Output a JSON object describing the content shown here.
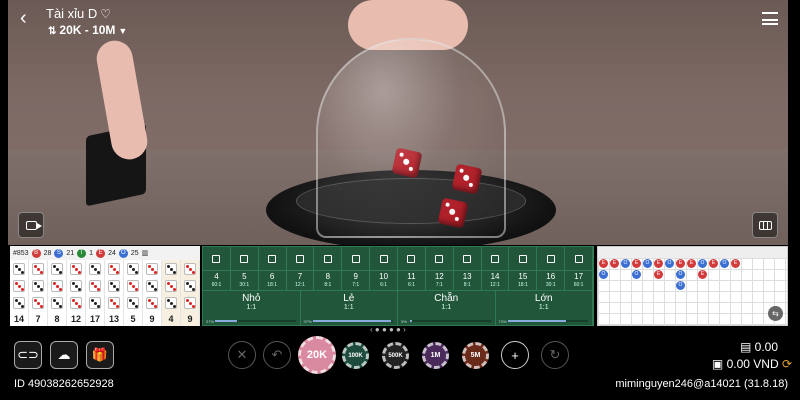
{
  "header": {
    "title": "Tài xỉu D",
    "limit": "20K - 10M"
  },
  "history": {
    "stats": {
      "round": "#853",
      "big": "28",
      "small": "21",
      "triple": "1",
      "even": "24",
      "odd": "25"
    },
    "sums": [
      "14",
      "7",
      "8",
      "12",
      "17",
      "13",
      "5",
      "9",
      "4",
      "9"
    ]
  },
  "board": {
    "totals": [
      {
        "n": "4",
        "o": "60:1"
      },
      {
        "n": "5",
        "o": "30:1"
      },
      {
        "n": "6",
        "o": "18:1"
      },
      {
        "n": "7",
        "o": "12:1"
      },
      {
        "n": "8",
        "o": "8:1"
      },
      {
        "n": "9",
        "o": "7:1"
      },
      {
        "n": "10",
        "o": "6:1"
      },
      {
        "n": "11",
        "o": "6:1"
      },
      {
        "n": "12",
        "o": "7:1"
      },
      {
        "n": "13",
        "o": "8:1"
      },
      {
        "n": "14",
        "o": "12:1"
      },
      {
        "n": "15",
        "o": "18:1"
      },
      {
        "n": "16",
        "o": "30:1"
      },
      {
        "n": "17",
        "o": "60:1"
      }
    ],
    "main": [
      {
        "name": "Nhỏ",
        "odds": "1:1",
        "pct": "27%",
        "fill": 0.27
      },
      {
        "name": "Lẻ",
        "odds": "1:1",
        "pct": "97%",
        "fill": 0.97
      },
      {
        "name": "Chẵn",
        "odds": "1:1",
        "pct": "3%",
        "fill": 0.03
      },
      {
        "name": "Lớn",
        "odds": "1:1",
        "pct": "73%",
        "fill": 0.73
      }
    ]
  },
  "chips": [
    "20K",
    "100K",
    "500K",
    "1M",
    "5M"
  ],
  "balance": {
    "bet": "0.00",
    "total": "0.00 VND"
  },
  "footer": {
    "id": "ID 49038262652928",
    "user": "miminguyen246@a14021 (31.8.18)"
  },
  "colors": {
    "board_green": "#21563a",
    "big": "#d23b3b",
    "small": "#3b6fd2",
    "chip_selected": "#d98aa0"
  }
}
